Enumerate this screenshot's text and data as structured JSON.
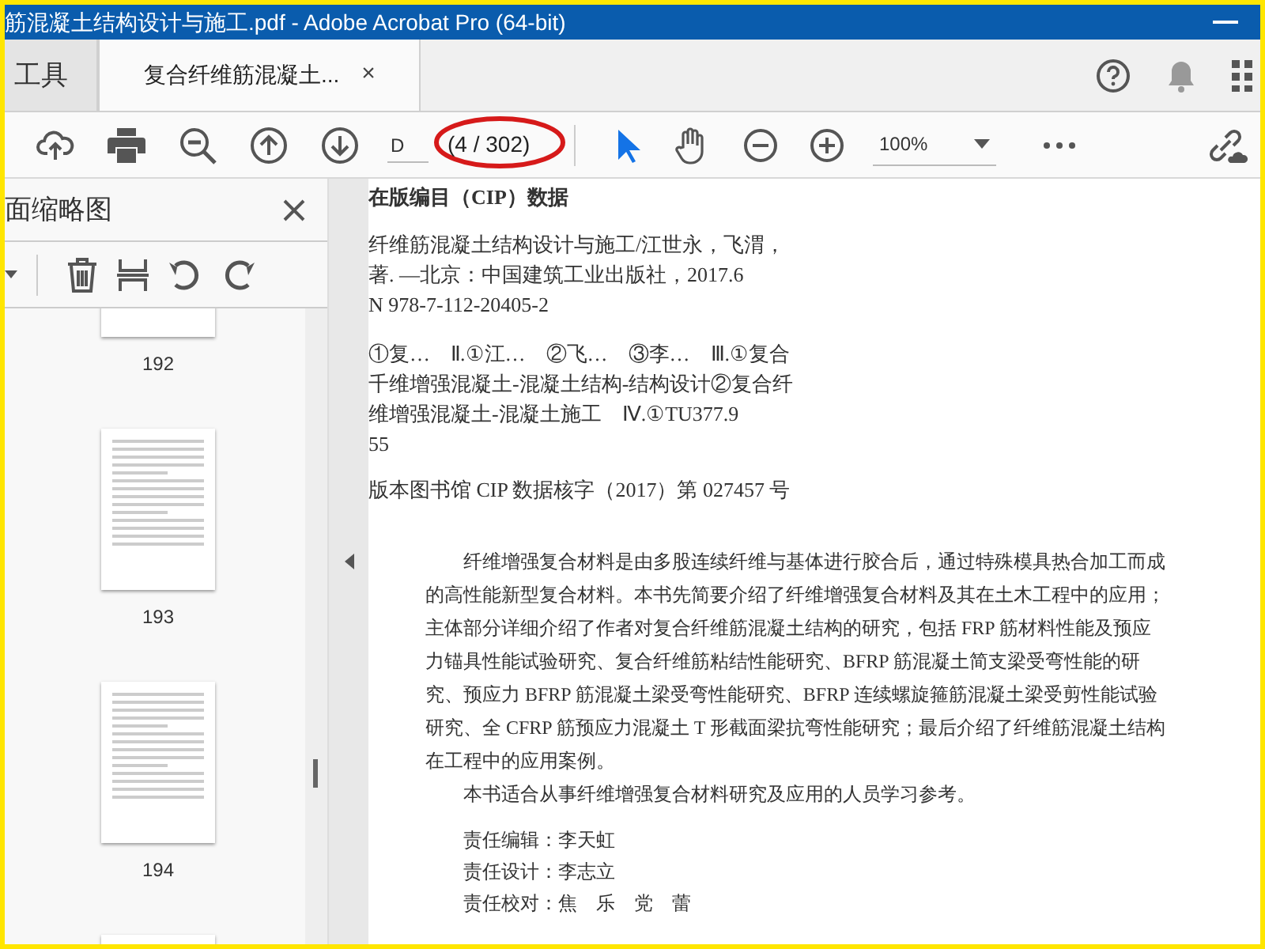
{
  "window": {
    "title": "筋混凝土结构设计与施工.pdf - Adobe Acrobat Pro (64-bit)"
  },
  "tabs": [
    {
      "label": "工具",
      "selected": false
    },
    {
      "label": "复合纤维筋混凝土...",
      "selected": true,
      "close_glyph": "×"
    }
  ],
  "toolbar": {
    "page_field": {
      "value": "D"
    },
    "page_count": "(4 / 302)",
    "zoom": "100%",
    "tools": [
      {
        "kind": "pointer",
        "selected": true
      },
      {
        "kind": "hand",
        "selected": false
      }
    ]
  },
  "sidebar": {
    "title": "面缩略图",
    "thumbnails": [
      {
        "kind": "labeled",
        "label": "192"
      },
      {
        "kind": "labeled",
        "label": "193"
      },
      {
        "kind": "labeled",
        "label": "194"
      },
      {
        "kind": "cut_off"
      }
    ]
  },
  "document": {
    "cip_heading": "在版编目（CIP）数据",
    "cip_lines": [
      "纤维筋混凝土结构设计与施工/江世永，飞渭，",
      "著. —北京：中国建筑工业出版社，2017.6",
      "N 978-7-112-20405-2"
    ],
    "classification_lines": [
      "①复…　Ⅱ.①江…　②飞…　③李…　Ⅲ.①复合",
      "千维增强混凝土-混凝土结构-结构设计②复合纤",
      "维增强混凝土-混凝土施工　Ⅳ.①TU377.9",
      "55"
    ],
    "cip_number": "版本图书馆 CIP 数据核字（2017）第 027457 号",
    "summary_lines": [
      "纤维增强复合材料是由多股连续纤维与基体进行胶合后，通过特殊模具热合加工而成",
      "的高性能新型复合材料。本书先简要介绍了纤维增强复合材料及其在土木工程中的应用；",
      "主体部分详细介绍了作者对复合纤维筋混凝土结构的研究，包括 FRP 筋材料性能及预应",
      "力锚具性能试验研究、复合纤维筋粘结性能研究、BFRP 筋混凝土简支梁受弯性能的研",
      "究、预应力 BFRP 筋混凝土梁受弯性能研究、BFRP 连续螺旋箍筋混凝土梁受剪性能试验",
      "研究、全 CFRP 筋预应力混凝土 T 形截面梁抗弯性能研究；最后介绍了纤维筋混凝土结构",
      "在工程中的应用案例。"
    ],
    "audience": "本书适合从事纤维增强复合材料研究及应用的人员学习参考。",
    "credits": [
      "责任编辑：李天虹",
      "责任设计：李志立",
      "责任校对：焦　乐　党　蕾"
    ]
  }
}
